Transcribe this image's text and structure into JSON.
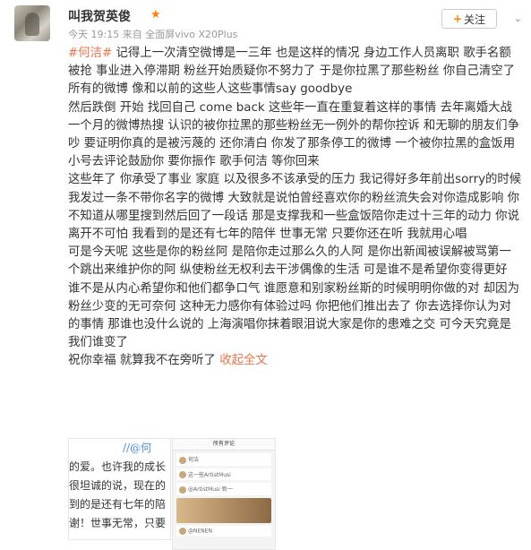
{
  "post": {
    "username": "叫我贺英俊",
    "meta": "今天 19:15 来自 全面屏vivo X20Plus",
    "follow_label": "关注",
    "topic": "#何洁#",
    "paragraphs": [
      " 记得上一次清空微博是一三年 也是这样的情况 身边工作人员离职 歌手名额被抢 事业进入停滞期 粉丝开始质疑你不努力了 于是你拉黑了那些粉丝 你自己清空了所有的微博 像和以前的这些人这些事情say goodbye",
      "然后跌倒 开始 找回自己 come back 这些年一直在重复着这样的事情 去年离婚大战 一个月的微博热搜 认识的被你拉黑的那些粉丝无一例外的帮你控诉 和无聊的朋友们争吵 要证明你真的是被污蔑的 还你清白 你发了那条停工的微博 一个被你拉黑的盒饭用小号去评论鼓励你 要你振作 歌手何洁 等你回来",
      "这些年了 你承受了事业 家庭 以及很多不该承受的压力 我记得好多年前出sorry的时候 我发过一条不带你名字的微博 大致就是说怕曾经喜欢你的粉丝流失会对你造成影响 你不知道从哪里搜到然后回了一段话 那是支撑我和一些盒饭陪你走过十三年的动力 你说离开不可怕 我看到的是还有七年的陪伴 世事无常 只要你还在听 我就用心唱",
      "可是今天呢 这些是你的粉丝阿 是陪你走过那么久的人阿 是你出新闻被误解被骂第一个跳出来维护你的阿 纵使粉丝无权利去干涉偶像的生活 可是谁不是希望你变得更好 谁不是从内心希望你和他们都争口气 谁愿意和别家粉丝斯的时候明明你做的对 却因为粉丝少变的无可奈何 这种无力感你有体验过吗 你把他们推出去了 你去选择你认为对的事情 那谁也没什么说的 上海演唱你抹着眼泪说大家是你的患难之交 可今天究竟是我们谁变了"
    ],
    "last_line": "祝你幸福 就算我不在旁听了 ",
    "collapse_label": "收起全文",
    "thumb1_lines": [
      "的爱。也许我的成长",
      "很坦诚的说，现在的",
      "到的是还有七年的陪",
      "谢！世事无常，只要"
    ],
    "thumb1_handle": "//@何",
    "thumb2_title": "所有评论",
    "thumb2_rows": [
      "何洁",
      "这一些ArtistMusi",
      "@ArtistMusi 新一",
      "@NENEN"
    ]
  }
}
